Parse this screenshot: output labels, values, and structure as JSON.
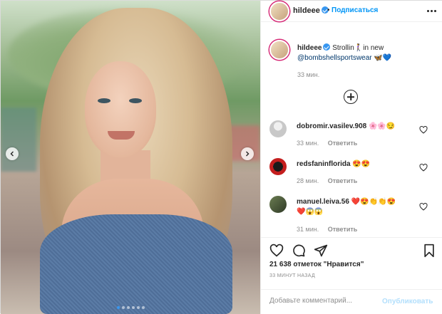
{
  "post": {
    "username": "hildeee",
    "follow_label": "Подписаться",
    "dot": "•",
    "caption": {
      "text_prefix": "Strollin",
      "emoji_1": "🚶‍♀️",
      "text_mid": "in new",
      "mention": "@bombshellsportswear",
      "emoji_2": "🦋",
      "emoji_3": "💙",
      "time": "33 мин."
    },
    "carousel": {
      "slides": 6,
      "active_index": 0
    }
  },
  "comments": [
    {
      "username": "dobromir.vasilev.908",
      "text": "🌸🌸😏",
      "time": "33 мин.",
      "reply_label": "Ответить"
    },
    {
      "username": "redsfaninflorida",
      "text": "😍😍",
      "time": "28 мин.",
      "reply_label": "Ответить"
    },
    {
      "username": "manuel.leiva.56",
      "text": "❤️😍👏👏😍",
      "text_line2": "❤️😱😱",
      "time": "31 мин.",
      "reply_label": "Ответить"
    }
  ],
  "actions": {
    "likes": "21 638 отметок \"Нравится\"",
    "posted": "33 МИНУТ НАЗАД"
  },
  "composer": {
    "placeholder": "Добавьте комментарий...",
    "publish_label": "Опубликовать"
  },
  "colors": {
    "accent": "#0095f6",
    "verified": "#3897f0",
    "muted": "#8e8e8e",
    "publish_disabled": "#b2dffc"
  }
}
